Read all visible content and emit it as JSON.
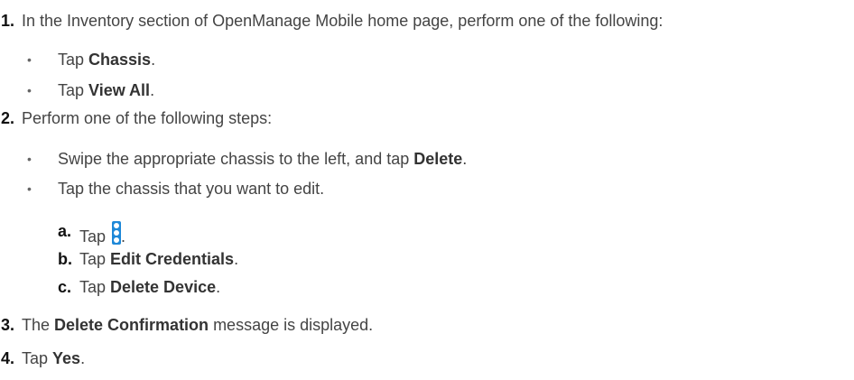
{
  "steps": {
    "s1": {
      "num": "1.",
      "text": "In the Inventory section of OpenManage Mobile home page, perform one of the following:",
      "bullets": [
        {
          "pre": "Tap ",
          "bold": "Chassis",
          "post": "."
        },
        {
          "pre": "Tap ",
          "bold": "View All",
          "post": "."
        }
      ]
    },
    "s2": {
      "num": "2.",
      "text": "Perform one of the following steps:",
      "bullet1": {
        "pre": "Swipe the appropriate chassis to the left, and tap ",
        "bold": "Delete",
        "post": "."
      },
      "bullet2": {
        "text": "Tap the chassis that you want to edit."
      },
      "substeps": [
        {
          "letter": "a.",
          "pre": "Tap ",
          "post": "."
        },
        {
          "letter": "b.",
          "pre": "Tap ",
          "bold": "Edit Credentials",
          "post": "."
        },
        {
          "letter": "c.",
          "pre": "Tap ",
          "bold": "Delete Device",
          "post": "."
        }
      ]
    },
    "s3": {
      "num": "3.",
      "pre": "The ",
      "bold": "Delete Confirmation",
      "post": " message is displayed."
    },
    "s4": {
      "num": "4.",
      "pre": "Tap ",
      "bold": "Yes",
      "post": "."
    }
  },
  "icons": {
    "more_options": "kebab-menu-icon",
    "bullet": "bullet-dot"
  },
  "colors": {
    "text": "#444444",
    "number": "#111111",
    "icon": "#1e88d8"
  }
}
